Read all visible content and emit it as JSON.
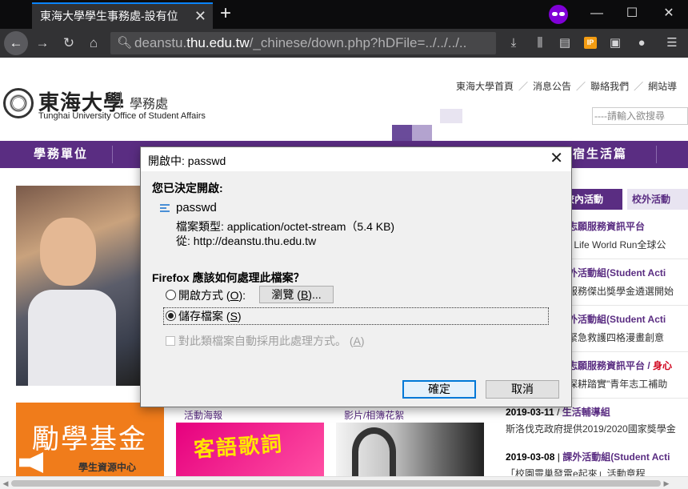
{
  "browser": {
    "tab_title": "東海大學學生事務處-設有位",
    "tab_close": "✕",
    "new_tab": "+",
    "url_prefix": "deanstu.",
    "url_host": "thu.edu.tw",
    "url_path": "/_chinese/down.php?hDFile=../../../..",
    "window_controls": {
      "minimize": "—",
      "maximize": "☐",
      "close": "✕"
    },
    "icons": [
      "back-icon",
      "forward-icon",
      "reload-icon",
      "home-icon",
      "download-icon",
      "library-icon",
      "reader-icon",
      "ip-icon",
      "screenshot-icon",
      "extension-icon",
      "menu-icon"
    ],
    "ip_badge": "IP"
  },
  "site": {
    "logo_cn": "東海大學",
    "logo_dept": "學務處",
    "logo_en": "Tunghai University Office of Student Affairs",
    "top_links": [
      "東海大學首頁",
      "消息公告",
      "聯絡我們",
      "網站導"
    ],
    "search_placeholder": "----請輸入欲搜尋",
    "menu": [
      "學務單位",
      "宿生活篇"
    ],
    "side_tabs": [
      "校內活動",
      "校外活動"
    ],
    "news": [
      {
        "title": "志願服務資訊平台",
        "red": "",
        "desc": "r Life World Run全球公"
      },
      {
        "title": "外活動組(Student Acti",
        "red": "",
        "desc": "服務傑出獎學金遴選開始"
      },
      {
        "title": "外活動組(Student Acti",
        "red": "",
        "desc": "緊急救護四格漫畫創意"
      },
      {
        "title": "志願服務資訊平台 / ",
        "red": "身心",
        "desc": "深耕踏實\"青年志工補助"
      }
    ],
    "news_bottom": [
      {
        "date": "2019-03-11",
        "title": "生活輔導組",
        "desc": "斯洛伐克政府提供2019/2020國家獎學金"
      },
      {
        "date": "2019-03-08",
        "title": "課外活動組(Student Acti",
        "desc": "「校園靈巢發電e起來」活動章程"
      }
    ],
    "fund_title": "勵學基金",
    "fund_sub": "學生資源中心",
    "poster_labels": [
      "活動海報",
      "影片/相簿花絮"
    ],
    "poster1_text": "客語歌詞"
  },
  "dialog": {
    "title": "開啟中: passwd",
    "close": "✕",
    "heading": "您已決定開啟:",
    "file_name": "passwd",
    "file_type": "檔案類型: application/octet-stream（5.4 KB)",
    "file_from": "從: http://deanstu.thu.edu.tw",
    "question": "Firefox 應該如何處理此檔案？",
    "open_with_label": "開啟方式 (",
    "open_with_key": "O",
    "open_with_end": "):",
    "browse_label": "瀏覽 (",
    "browse_key": "B",
    "browse_end": ")...",
    "save_label": "儲存檔案 (",
    "save_key": "S",
    "save_end": ")",
    "auto_label": "對此類檔案自動採用此處理方式。 (",
    "auto_key": "A",
    "auto_end": ")",
    "ok": "確定",
    "cancel": "取消",
    "selected_option": "save"
  }
}
